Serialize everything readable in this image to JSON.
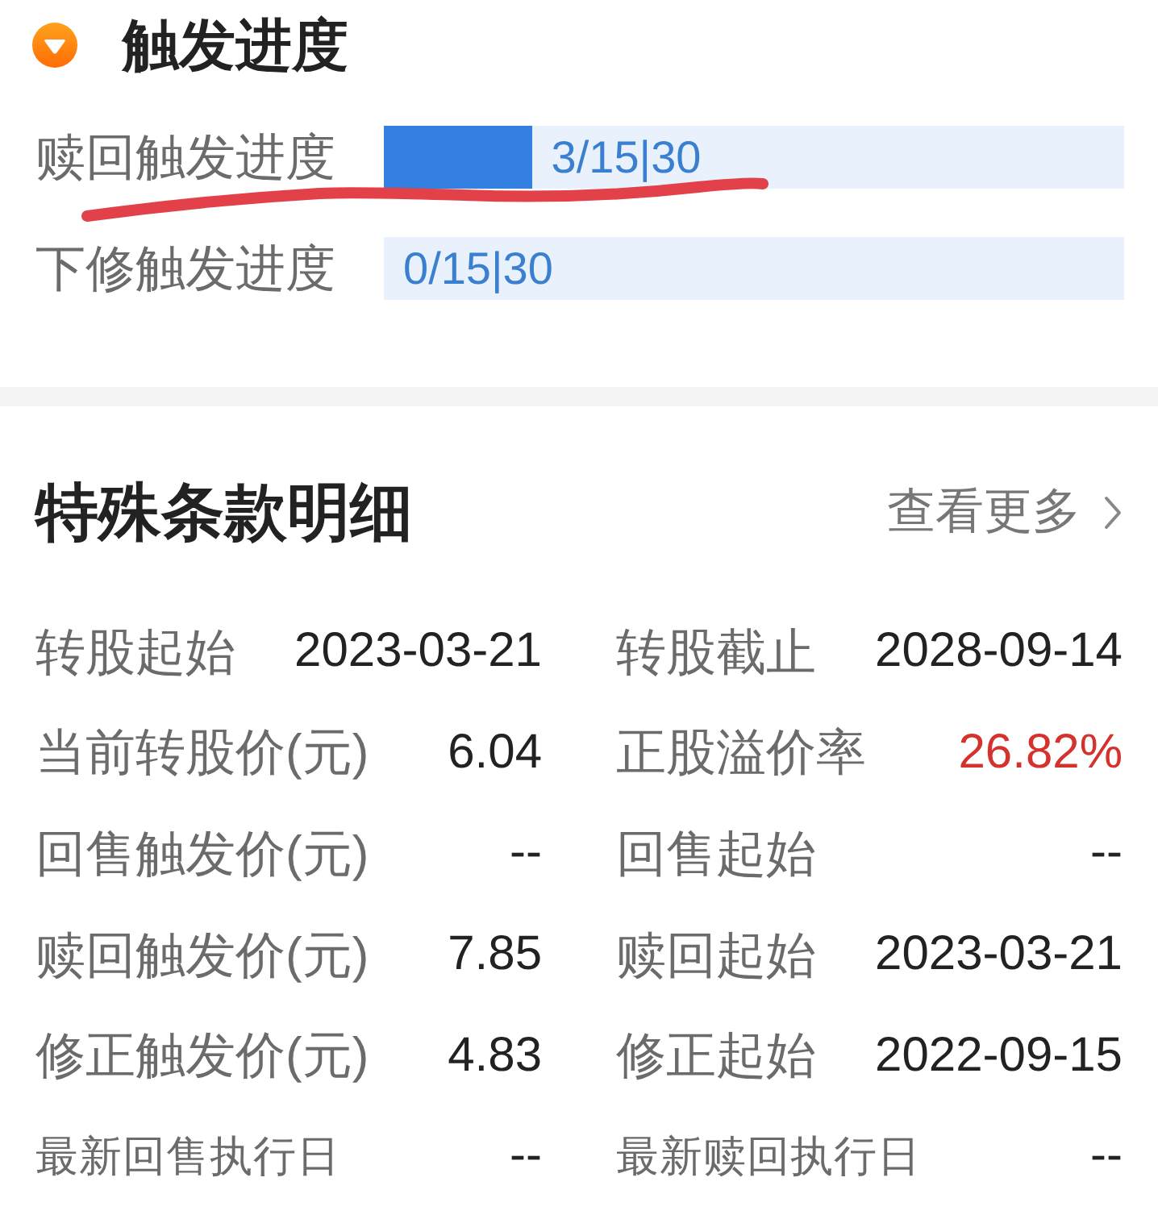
{
  "trigger_progress": {
    "title": "触发进度",
    "rows": [
      {
        "label": "赎回触发进度",
        "level": 0.2,
        "reading": "3/15|30"
      },
      {
        "label": "下修触发进度",
        "level": 0,
        "reading": "0/15|30"
      }
    ]
  },
  "special_terms": {
    "title": "特殊条款明细",
    "more_link": "查看更多",
    "items": [
      {
        "kind": "normal",
        "label": "转股起始",
        "value": "2023-03-21",
        "highlight": false
      },
      {
        "kind": "normal",
        "label": "转股截止",
        "value": "2028-09-14",
        "highlight": false
      },
      {
        "kind": "normal",
        "label": "当前转股价(元)",
        "value": "6.04",
        "highlight": false
      },
      {
        "kind": "normal",
        "label": "正股溢价率",
        "value": "26.82%",
        "highlight": true
      },
      {
        "kind": "normal",
        "label": "回售触发价(元)",
        "value": "--",
        "highlight": false
      },
      {
        "kind": "normal",
        "label": "回售起始",
        "value": "--",
        "highlight": false
      },
      {
        "kind": "normal",
        "label": "赎回触发价(元)",
        "value": "7.85",
        "highlight": false
      },
      {
        "kind": "normal",
        "label": "赎回起始",
        "value": "2023-03-21",
        "highlight": false
      },
      {
        "kind": "normal",
        "label": "修正触发价(元)",
        "value": "4.83",
        "highlight": false
      },
      {
        "kind": "normal",
        "label": "修正起始",
        "value": "2022-09-15",
        "highlight": false
      },
      {
        "kind": "compact",
        "label": "最新回售执行日",
        "value": "--",
        "highlight": false
      },
      {
        "kind": "compact",
        "label": "最新赎回执行日",
        "value": "--",
        "highlight": false
      }
    ]
  }
}
